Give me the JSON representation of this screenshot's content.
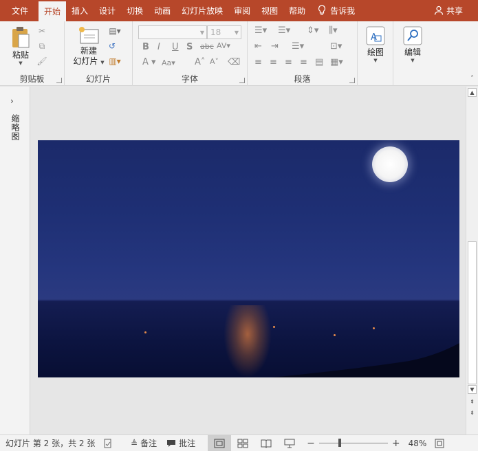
{
  "tabs": [
    "文件",
    "开始",
    "插入",
    "设计",
    "切换",
    "动画",
    "幻灯片放映",
    "审阅",
    "视图",
    "帮助"
  ],
  "active_tab": "开始",
  "tell_me": "告诉我",
  "share": "共享",
  "ribbon": {
    "clipboard": {
      "group_label": "剪贴板",
      "paste_label": "粘贴"
    },
    "slides": {
      "group_label": "幻灯片",
      "new_slide_line1": "新建",
      "new_slide_line2": "幻灯片"
    },
    "font": {
      "group_label": "字体",
      "font_size": "18"
    },
    "paragraph": {
      "group_label": "段落"
    },
    "drawing": {
      "draw_label": "绘图"
    },
    "editing": {
      "edit_label": "编辑"
    }
  },
  "thumbnail_pane": {
    "label": "缩略图"
  },
  "status": {
    "slide_info": "幻灯片 第 2 张，共 2 张",
    "notes": "备注",
    "comments": "批注",
    "zoom": "48%",
    "zoom_fraction": 0.48
  },
  "colors": {
    "accent": "#b7472a",
    "ribbon_bg": "#f3f3f3",
    "sky": "#1e2f74",
    "sea": "#0c1440",
    "moon": "#ffffff",
    "reflection": "#d6783c"
  },
  "icons": {
    "tell_me": "lightbulb-icon",
    "share": "person-icon",
    "expand": "chevron-right-icon",
    "fit": "fit-window-icon"
  }
}
